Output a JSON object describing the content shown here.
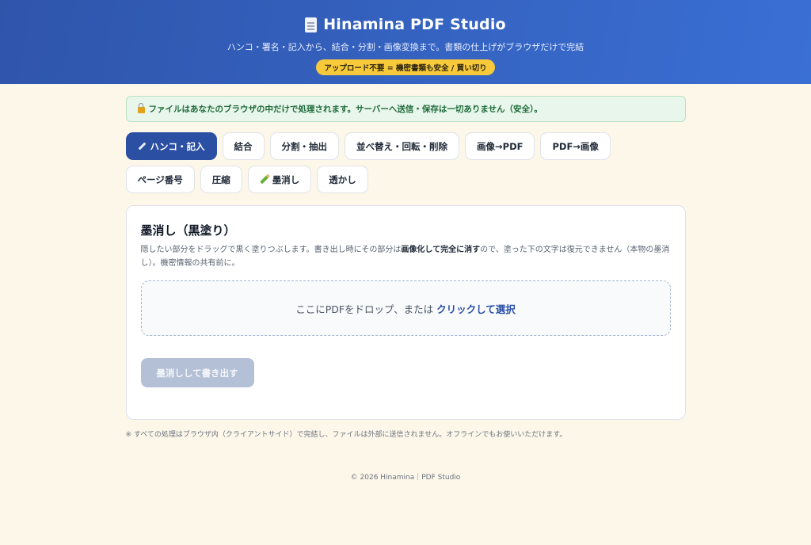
{
  "header": {
    "title": "Hinamina PDF Studio",
    "subtitle": "ハンコ・署名・記入から、結合・分割・画像変換まで。書類の仕上げがブラウザだけで完結",
    "badge": "アップロード不要 = 機密書類も安全 / 買い切り"
  },
  "notice": "ファイルはあなたのブラウザの中だけで処理されます。サーバーへ送信・保存は一切ありません（安全）。",
  "tabs": [
    {
      "label": "ハンコ・記入"
    },
    {
      "label": "結合"
    },
    {
      "label": "分割・抽出"
    },
    {
      "label": "並べ替え・回転・削除"
    },
    {
      "label": "画像→PDF"
    },
    {
      "label": "PDF→画像"
    },
    {
      "label": "ページ番号"
    },
    {
      "label": "圧縮"
    },
    {
      "label": "墨消し"
    },
    {
      "label": "透かし"
    }
  ],
  "card": {
    "title": "墨消し（黒塗り）",
    "desc_part1": "隠したい部分をドラッグで黒く塗りつぶします。書き出し時にその部分は",
    "desc_bold": "画像化して完全に消す",
    "desc_part2": "ので、塗った下の文字は復元できません（本物の墨消し）。機密情報の共有前に。",
    "dropzone_text": "ここにPDFをドロップ、または",
    "dropzone_link": "クリックして選択",
    "export_label": "墨消しして書き出す"
  },
  "footnote": "※ すべての処理はブラウザ内（クライアントサイド）で完結し、ファイルは外部に送信されません。オフラインでもお使いいただけます。",
  "copyright": "© 2026 Hinamina｜PDF Studio",
  "colors": {
    "header_start": "#2f55ab",
    "header_end": "#3a6fd4",
    "accent": "#2a4fa3",
    "badge": "#f7c93b",
    "notice_bg": "#e8f6ec",
    "page_bg": "#fdf7e9",
    "disabled_button": "#b4c0d6"
  }
}
